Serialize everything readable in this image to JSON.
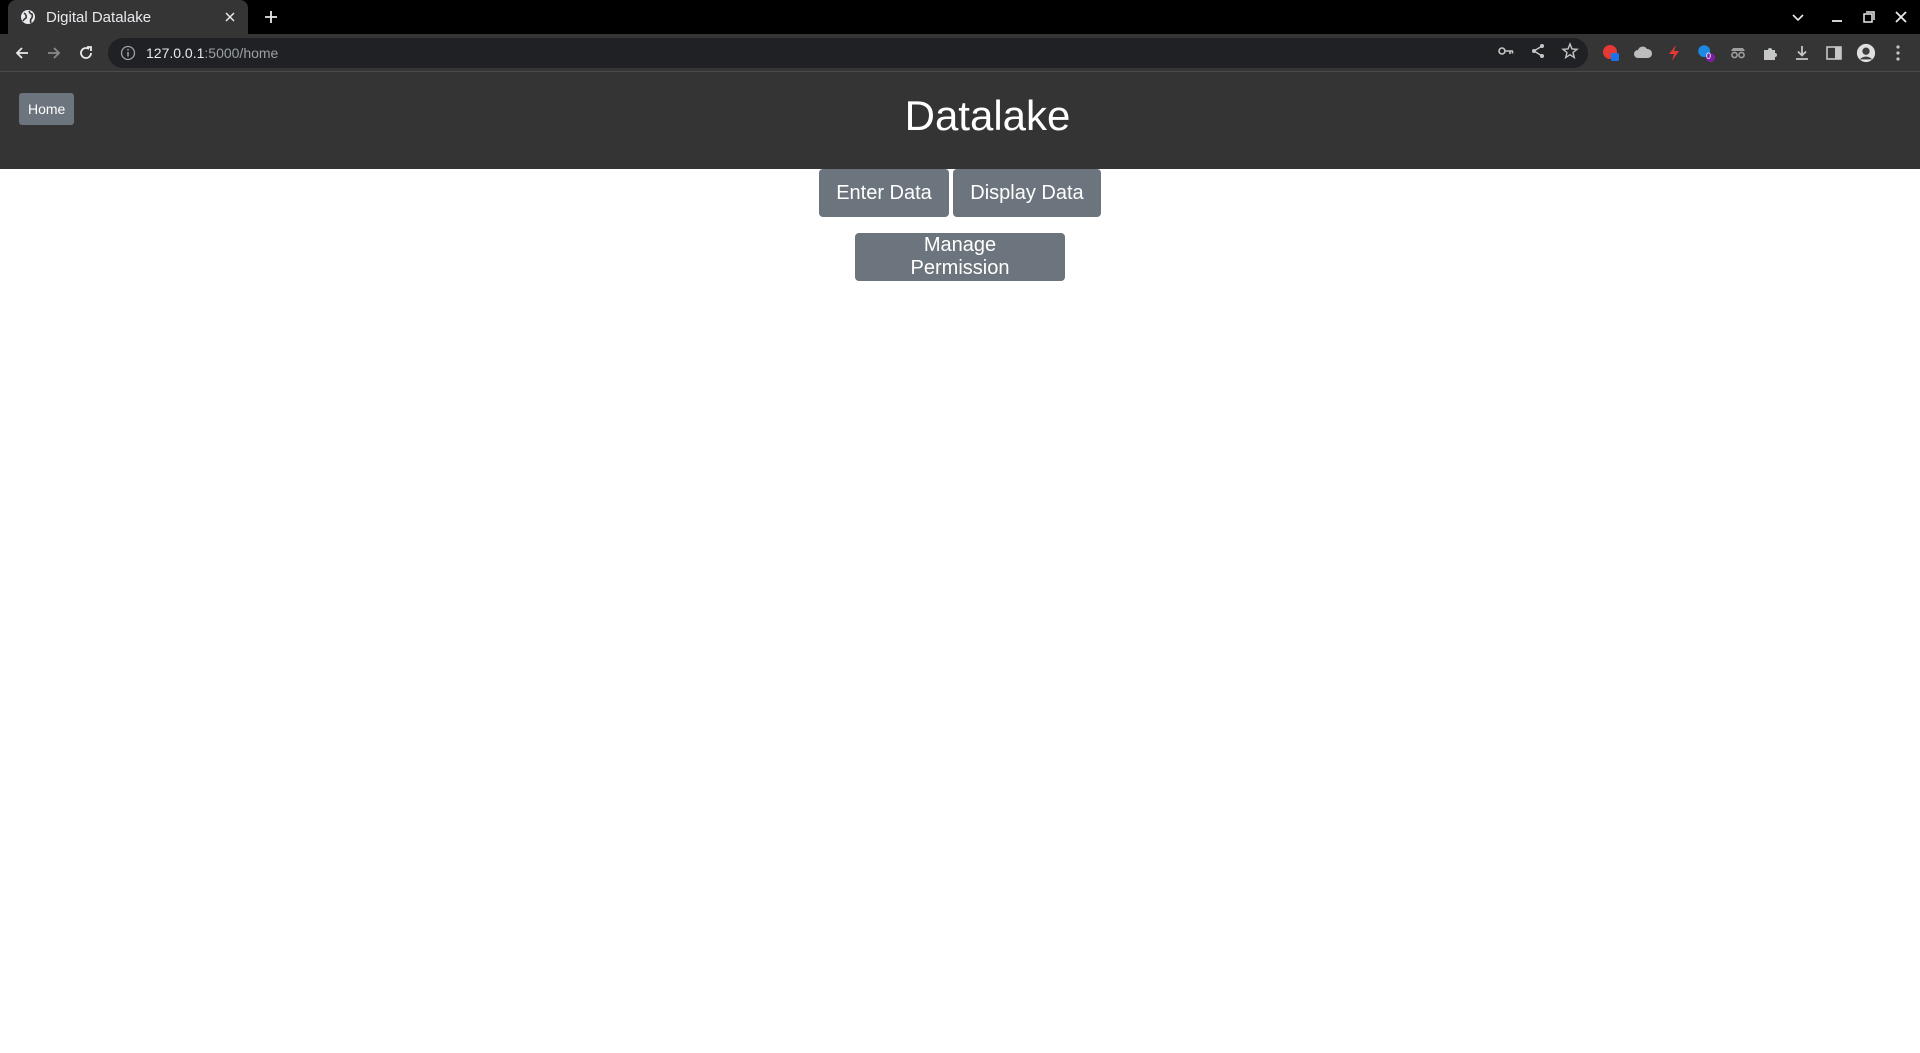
{
  "browser": {
    "tab_title": "Digital Datalake",
    "url_host": "127.0.0.1",
    "url_path": ":5000/home",
    "extension_badge": "0"
  },
  "app": {
    "home_label": "Home",
    "title": "Datalake"
  },
  "actions": {
    "enter_data": "Enter Data",
    "display_data": "Display Data",
    "manage_permission": "Manage Permission"
  },
  "colors": {
    "header_bg": "#343434",
    "button_bg": "#6c757d",
    "browser_frame": "#000000",
    "browser_toolbar": "#353535"
  }
}
